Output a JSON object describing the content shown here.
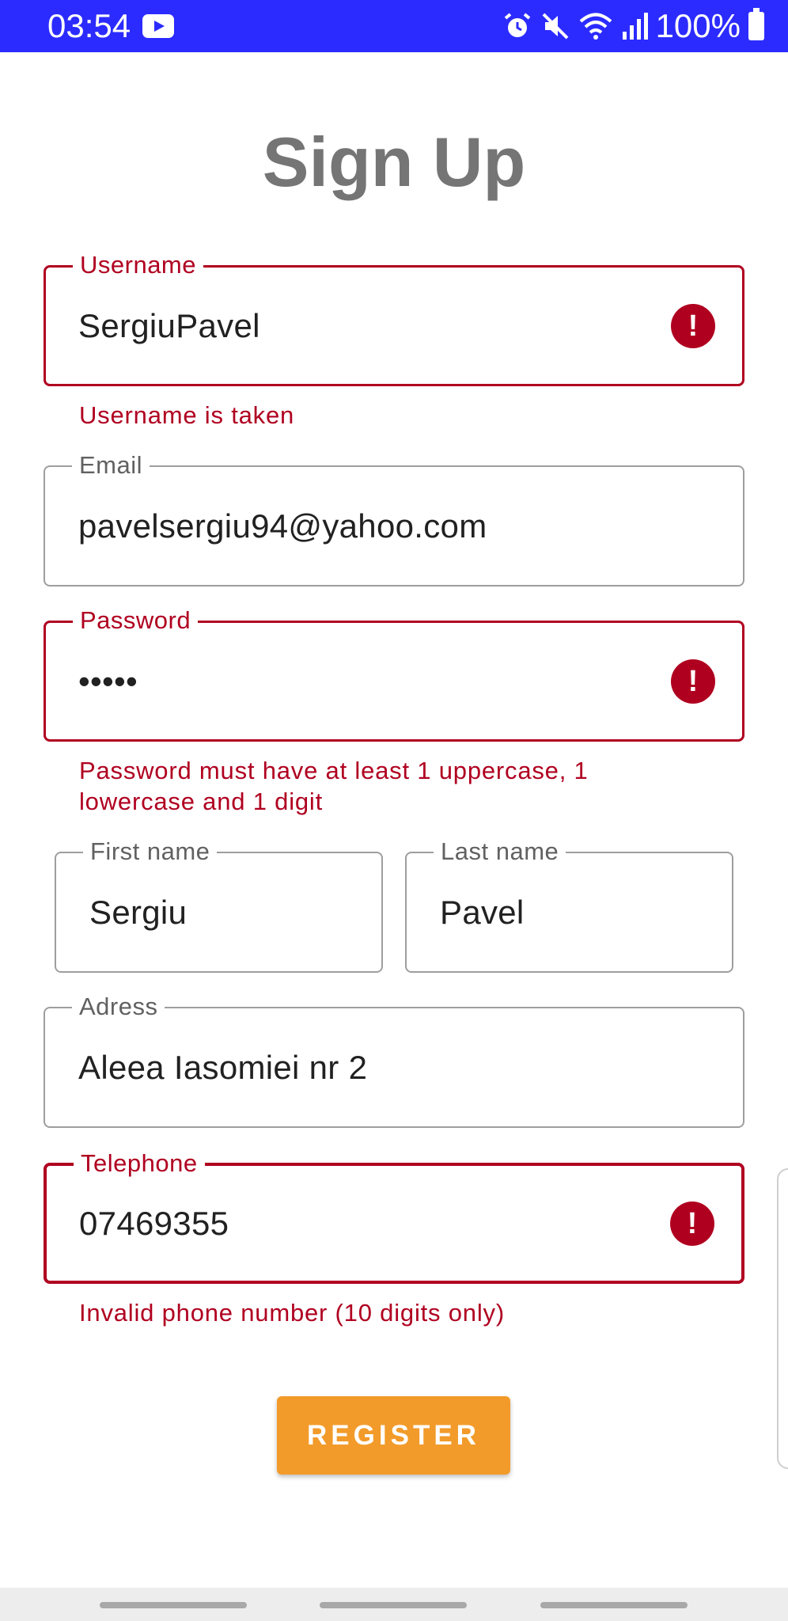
{
  "status_bar": {
    "time": "03:54",
    "battery": "100%",
    "icons": [
      "youtube-icon",
      "alarm-icon",
      "mute-icon",
      "wifi-icon",
      "signal-icon",
      "battery-icon"
    ]
  },
  "title": "Sign Up",
  "colors": {
    "status_bar": "#2b2bff",
    "error": "#b00020",
    "button": "#f29b2a",
    "title": "#757575"
  },
  "fields": {
    "username": {
      "label": "Username",
      "value": "SergiuPavel",
      "error": "Username is taken"
    },
    "email": {
      "label": "Email",
      "value": "pavelsergiu94@yahoo.com"
    },
    "password": {
      "label": "Password",
      "value": "•••••",
      "error": "Password must have at least 1 uppercase, 1 lowercase and 1 digit"
    },
    "first_name": {
      "label": "First name",
      "value": "Sergiu"
    },
    "last_name": {
      "label": "Last name",
      "value": "Pavel"
    },
    "address": {
      "label": "Adress",
      "value": "Aleea Iasomiei nr 2"
    },
    "telephone": {
      "label": "Telephone",
      "value": "07469355",
      "error": "Invalid phone number (10 digits only)"
    }
  },
  "register_label": "REGISTER"
}
